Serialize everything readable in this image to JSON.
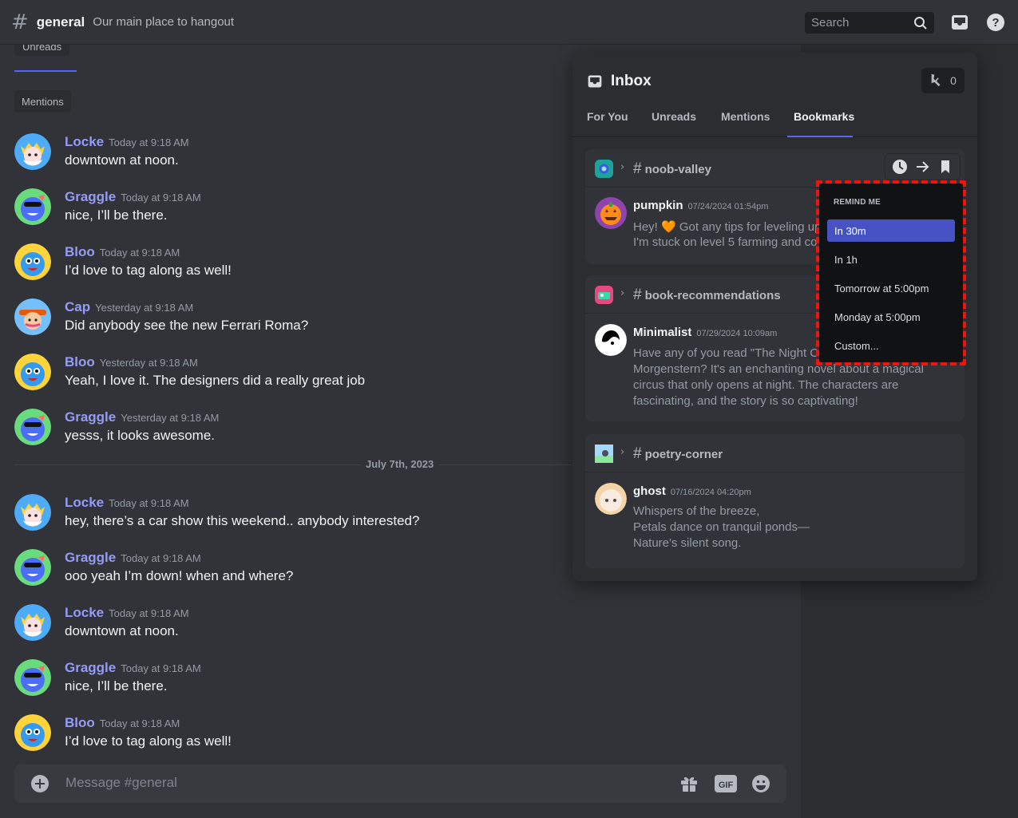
{
  "header": {
    "channel_name": "general",
    "topic": "Our main place to hangout",
    "search_placeholder": "Search",
    "icons": [
      "hashtag-icon",
      "search-icon",
      "inbox-icon",
      "help-icon"
    ]
  },
  "filters": {
    "unreads": "Unreads",
    "mentions": "Mentions"
  },
  "messages": [
    {
      "author": "Locke",
      "timestamp": "Today at 9:18 AM",
      "text": "downtown at noon.",
      "color": "#949cf7"
    },
    {
      "author": "Graggle",
      "timestamp": "Today at 9:18 AM",
      "text": "nice, I’ll be there.",
      "color": "#949cf7"
    },
    {
      "author": "Bloo",
      "timestamp": "Today at 9:18 AM",
      "text": "I’d love to tag along as well!",
      "color": "#949cf7"
    },
    {
      "author": "Cap",
      "timestamp": "Yesterday at 9:18 AM",
      "text": "Did anybody see the new Ferrari Roma?",
      "color": "#949cf7"
    },
    {
      "author": "Bloo",
      "timestamp": "Yesterday at 9:18 AM",
      "text": "Yeah, I love it. The designers did a really great job",
      "color": "#949cf7"
    },
    {
      "author": "Graggle",
      "timestamp": "Yesterday at 9:18 AM",
      "text": "yesss, it looks awesome.",
      "color": "#949cf7"
    },
    {
      "author": "Locke",
      "timestamp": "Today at 9:18 AM",
      "text": "hey, there’s a car show this weekend.. anybody interested?",
      "color": "#949cf7"
    },
    {
      "author": "Graggle",
      "timestamp": "Today at 9:18 AM",
      "text": "ooo yeah I’m down! when and where?",
      "color": "#949cf7"
    },
    {
      "author": "Locke",
      "timestamp": "Today at 9:18 AM",
      "text": "downtown at noon.",
      "color": "#949cf7"
    },
    {
      "author": "Graggle",
      "timestamp": "Today at 9:18 AM",
      "text": "nice, I’ll be there.",
      "color": "#949cf7"
    },
    {
      "author": "Bloo",
      "timestamp": "Today at 9:18 AM",
      "text": "I’d love to tag along as well!",
      "color": "#949cf7"
    }
  ],
  "date_divider": "July 7th, 2023",
  "composer": {
    "placeholder": "Message #general"
  },
  "inbox": {
    "title": "Inbox",
    "mention_count": "0",
    "tabs": [
      "For You",
      "Unreads",
      "Mentions",
      "Bookmarks"
    ],
    "active_tab": "Bookmarks",
    "cards": [
      {
        "channel": "noob-valley",
        "author": "pumpkin",
        "timestamp": "07/24/2024 01:54pm",
        "lines": [
          "Hey! 🧡 Got any tips for leveling up",
          "I'm stuck on level 5 farming and co"
        ]
      },
      {
        "channel": "book-recommendations",
        "author": "Minimalist",
        "timestamp": "07/29/2024 10:09am",
        "lines": [
          "Have any of you read \"The Night Ci",
          "Morgenstern? It's an enchanting novel about a magical",
          "circus that only opens at night. The characters are",
          "fascinating, and the story is so captivating!"
        ]
      },
      {
        "channel": "poetry-corner",
        "author": "ghost",
        "timestamp": "07/16/2024 04:20pm",
        "lines": [
          "Whispers of the breeze,",
          "Petals dance on tranquil ponds—",
          "Nature's silent song."
        ]
      }
    ]
  },
  "remind_menu": {
    "title": "REMIND ME",
    "options": [
      "In 30m",
      "In 1h",
      "Tomorrow at 5:00pm",
      "Monday at 5:00pm",
      "Custom..."
    ],
    "selected": "In 30m"
  },
  "colors": {
    "accent": "#5865f2",
    "highlight_outline": "#f0120b",
    "username": "#949cf7"
  }
}
